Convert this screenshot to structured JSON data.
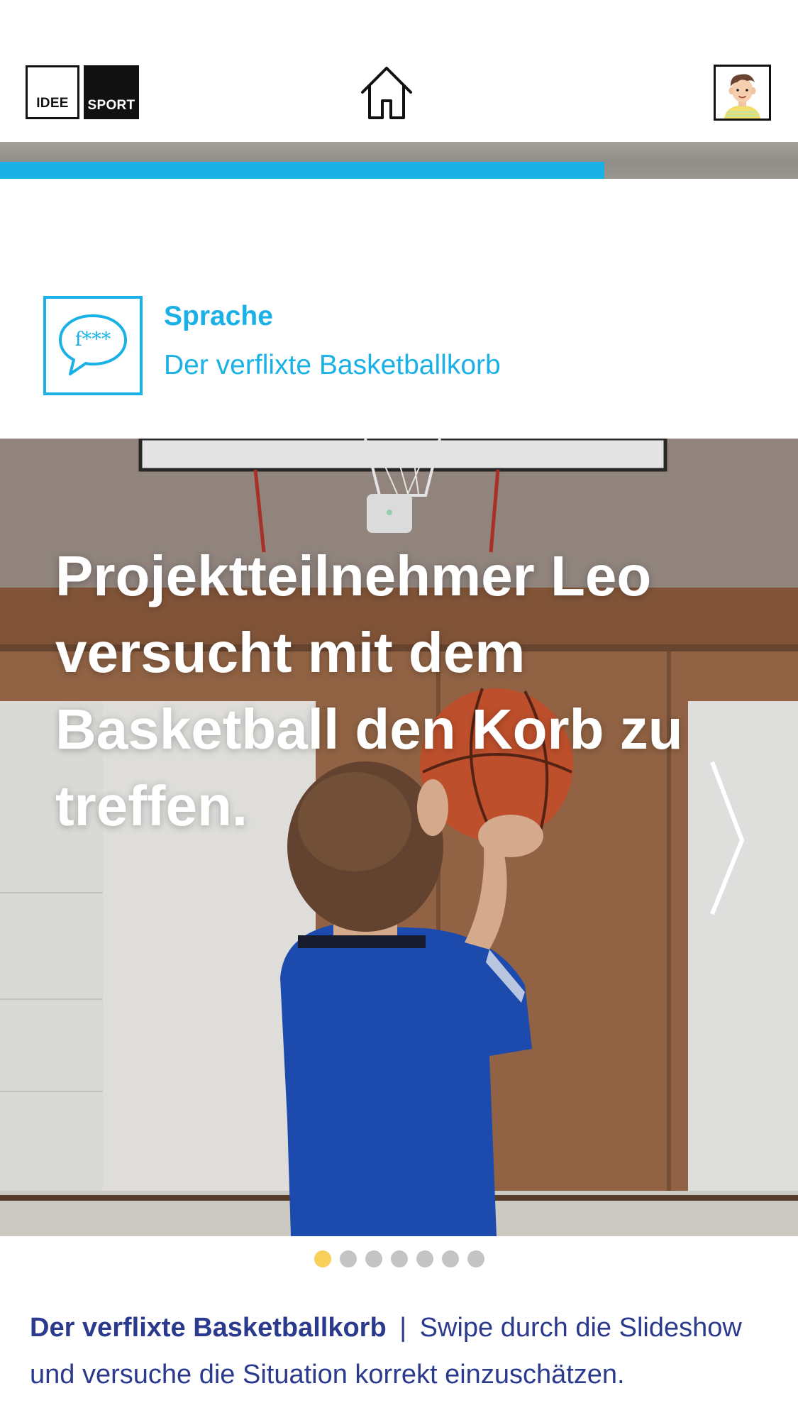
{
  "header": {
    "logo_left": "IDEE",
    "logo_right": "SPORT"
  },
  "progress": {
    "fraction": 0.757
  },
  "category": {
    "icon_text": "f***",
    "title": "Sprache",
    "subtitle": "Der verflixte Basketballkorb"
  },
  "slide": {
    "caption": "Projektteilnehmer Leo versucht mit dem Basketball den Korb zu treffen.",
    "total": 7,
    "active_index": 0
  },
  "description": {
    "title": "Der verflixte Basketballkorb",
    "separator": "|",
    "text": "Swipe durch die Slideshow und versuche die Situation korrekt einzuschätzen."
  },
  "colors": {
    "accent": "#1ab1e6",
    "text_dark_blue": "#2b3a8c",
    "dot_active": "#f7cf5a",
    "dot_inactive": "#c4c4c4"
  }
}
